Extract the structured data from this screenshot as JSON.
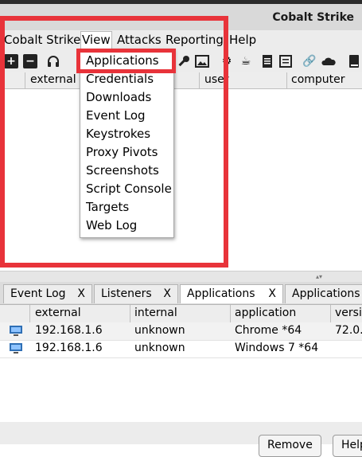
{
  "window": {
    "title": "Cobalt Strike"
  },
  "menubar": {
    "items": [
      "Cobalt Strike",
      "View",
      "Attacks",
      "Reporting",
      "Help"
    ],
    "open_menu": "View"
  },
  "view_menu": {
    "items": [
      "Applications",
      "Credentials",
      "Downloads",
      "Event Log",
      "Keystrokes",
      "Proxy Pivots",
      "Screenshots",
      "Script Console",
      "Targets",
      "Web Log"
    ],
    "highlighted": "Applications"
  },
  "toolbar": {
    "icons": [
      "plus-icon",
      "minus-icon",
      "headphones-icon",
      "key-icon",
      "image-icon",
      "gear-icon",
      "coffee-icon",
      "document-icon",
      "notes-icon",
      "link-icon",
      "cloud-icon",
      "book-icon"
    ]
  },
  "upper_table": {
    "columns": [
      "external",
      "user",
      "computer"
    ]
  },
  "tabs": [
    {
      "label": "Event Log",
      "close": "X"
    },
    {
      "label": "Listeners",
      "close": "X"
    },
    {
      "label": "Applications",
      "close": "X"
    },
    {
      "label": "Applications",
      "close": ""
    }
  ],
  "apps_table": {
    "columns": [
      "external",
      "internal",
      "application",
      "versi"
    ],
    "rows": [
      {
        "external": "192.168.1.6",
        "internal": "unknown",
        "application": "Chrome *64",
        "version": "72.0."
      },
      {
        "external": "192.168.1.6",
        "internal": "unknown",
        "application": "Windows 7 *64",
        "version": ""
      }
    ]
  },
  "buttons": {
    "remove": "Remove",
    "help": "Help"
  },
  "colors": {
    "highlight_box": "#e8333a",
    "menu_bg": "#ececec"
  }
}
